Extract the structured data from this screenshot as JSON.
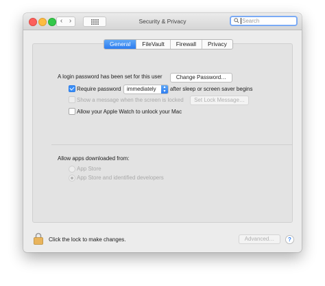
{
  "window": {
    "title": "Security & Privacy",
    "nav": {
      "back_glyph": "‹",
      "forward_glyph": "›"
    },
    "search": {
      "placeholder": "Search"
    }
  },
  "tabs": [
    {
      "label": "General",
      "active": true
    },
    {
      "label": "FileVault",
      "active": false
    },
    {
      "label": "Firewall",
      "active": false
    },
    {
      "label": "Privacy",
      "active": false
    }
  ],
  "general": {
    "password_set_text": "A login password has been set for this user",
    "change_password_button": "Change Password…",
    "require_password": {
      "checked": true,
      "label": "Require password",
      "delay_value": "immediately",
      "suffix": "after sleep or screen saver begins"
    },
    "show_message": {
      "checked": false,
      "enabled": false,
      "label": "Show a message when the screen is locked",
      "button": "Set Lock Message…"
    },
    "apple_watch": {
      "checked": false,
      "label": "Allow your Apple Watch to unlock your Mac"
    },
    "allow_apps_heading": "Allow apps downloaded from:",
    "allow_apps_options": [
      {
        "label": "App Store",
        "selected": false,
        "enabled": false
      },
      {
        "label": "App Store and identified developers",
        "selected": true,
        "enabled": false
      }
    ]
  },
  "footer": {
    "lock_text": "Click the lock to make changes.",
    "advanced_button": "Advanced…",
    "help_glyph": "?"
  },
  "icons": [
    "search-icon",
    "lock-icon",
    "grid-icon",
    "back-icon",
    "forward-icon",
    "popup-arrows-icon"
  ],
  "colors": {
    "accent": "#2c7cf0",
    "window_bg": "#ececec",
    "panel_bg": "#e3e3e3"
  }
}
